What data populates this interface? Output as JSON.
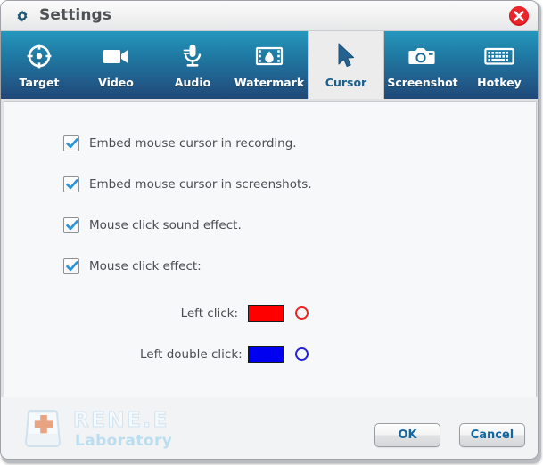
{
  "window": {
    "title": "Settings",
    "gear_icon": "gear-icon",
    "close_icon": "close-icon"
  },
  "tabs": [
    {
      "label": "Target",
      "icon": "target-icon",
      "active": false
    },
    {
      "label": "Video",
      "icon": "video-camera-icon",
      "active": false
    },
    {
      "label": "Audio",
      "icon": "microphone-icon",
      "active": false
    },
    {
      "label": "Watermark",
      "icon": "watermark-icon",
      "active": false
    },
    {
      "label": "Cursor",
      "icon": "cursor-arrow-icon",
      "active": true
    },
    {
      "label": "Screenshot",
      "icon": "camera-icon",
      "active": false
    },
    {
      "label": "Hotkey",
      "icon": "keyboard-icon",
      "active": false
    }
  ],
  "options": [
    {
      "label": "Embed mouse cursor in recording.",
      "checked": true
    },
    {
      "label": "Embed mouse cursor in screenshots.",
      "checked": true
    },
    {
      "label": "Mouse click sound effect.",
      "checked": true
    },
    {
      "label": "Mouse click effect:",
      "checked": true
    }
  ],
  "click_colors": [
    {
      "label": "Left click:",
      "color": "#ff0000",
      "ring_color": "#ee2222"
    },
    {
      "label": "Left double click:",
      "color": "#0000f0",
      "ring_color": "#2222dd"
    }
  ],
  "watermark": {
    "brand": "RENE.E",
    "sub": "Laboratory",
    "icon": "keycap-cross-icon"
  },
  "footer": {
    "ok_label": "OK",
    "cancel_label": "Cancel"
  },
  "colors": {
    "tab_bar_top": "#2597bd",
    "tab_bar_bottom": "#204876",
    "active_tab_bg": "#ececec",
    "active_tab_text": "#1b5f8c",
    "button_text": "#14679e",
    "content_bg": "#f7f8fa",
    "close_red": "#e01b22"
  }
}
